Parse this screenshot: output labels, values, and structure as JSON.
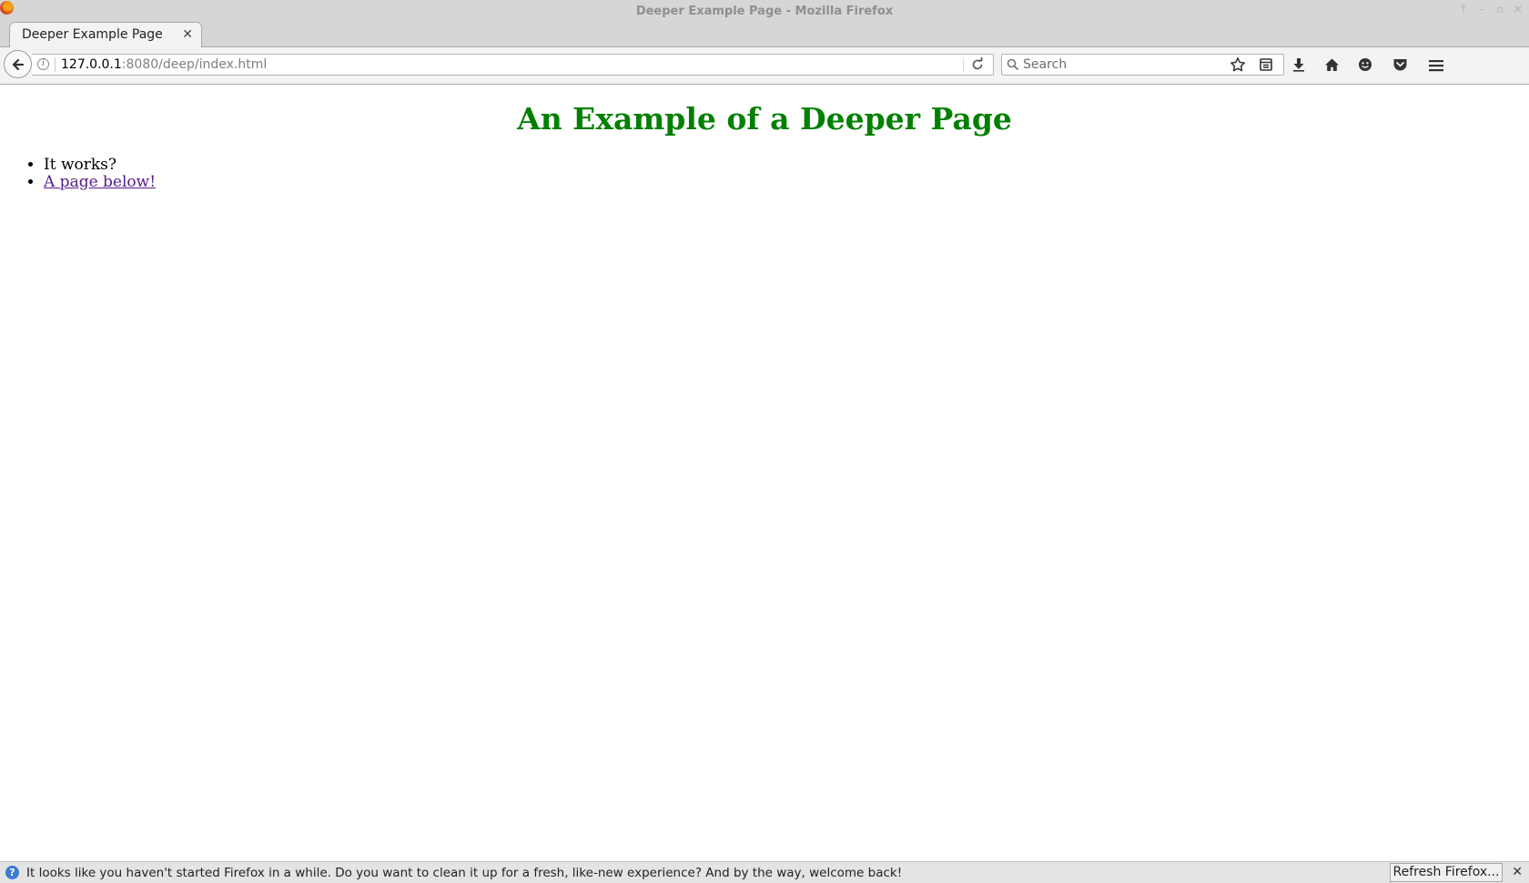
{
  "window": {
    "title": "Deeper Example Page - Mozilla Firefox"
  },
  "tabs": [
    {
      "title": "Deeper Example Page",
      "active": true
    }
  ],
  "toolbar": {
    "new_tab_symbol": "+",
    "url_host": "127.0.0.1",
    "url_rest": ":8080/deep/index.html",
    "search_placeholder": "Search",
    "icons": [
      "back-icon",
      "info-icon",
      "reload-icon",
      "search-icon",
      "bookmark-star-icon",
      "reading-list-icon",
      "download-icon",
      "home-icon",
      "smiley-icon",
      "pocket-icon",
      "hamburger-menu-icon"
    ]
  },
  "page": {
    "heading": "An Example of a Deeper Page",
    "heading_color": "#008000",
    "items": [
      {
        "text": "It works?",
        "is_link": false
      },
      {
        "text": "A page below!",
        "is_link": true
      }
    ],
    "link_color": "#551a8b"
  },
  "notification": {
    "message": "It looks like you haven't started Firefox in a while. Do you want to clean it up for a fresh, like-new experience? And by the way, welcome back!",
    "button_label": "Refresh Firefox..."
  }
}
